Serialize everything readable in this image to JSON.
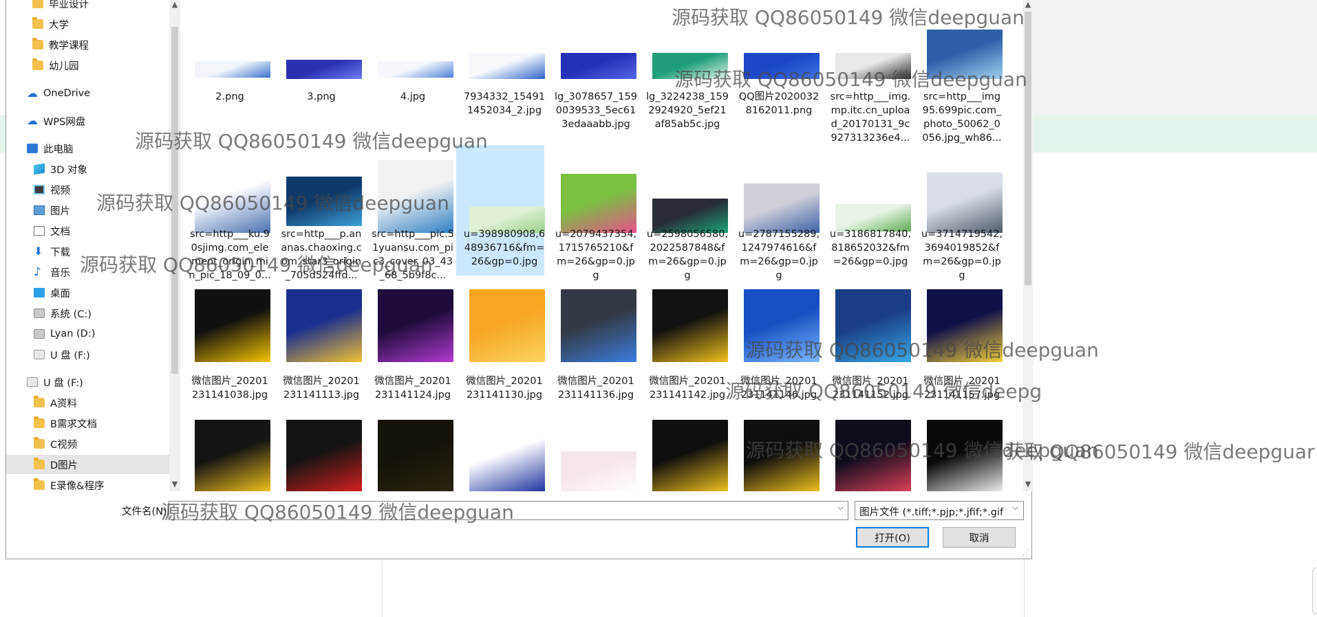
{
  "navigation": {
    "items": [
      {
        "label": "毕业设计",
        "icon": "folder-icon",
        "name": "nav-folder-graduation"
      },
      {
        "label": "大学",
        "icon": "folder-icon",
        "name": "nav-folder-university"
      },
      {
        "label": "教学课程",
        "icon": "folder-icon",
        "name": "nav-folder-courses"
      },
      {
        "label": "幼儿园",
        "icon": "folder-icon",
        "name": "nav-folder-kindergarten"
      },
      {
        "label": "OneDrive",
        "icon": "cloud-icon",
        "name": "nav-onedrive"
      },
      {
        "label": "WPS网盘",
        "icon": "cloud-icon",
        "name": "nav-wps-cloud"
      },
      {
        "label": "此电脑",
        "icon": "computer-icon",
        "name": "nav-this-pc"
      },
      {
        "label": "3D 对象",
        "icon": "cube-icon",
        "name": "nav-3d-objects"
      },
      {
        "label": "视频",
        "icon": "video-icon",
        "name": "nav-videos"
      },
      {
        "label": "图片",
        "icon": "picture-icon",
        "name": "nav-pictures"
      },
      {
        "label": "文档",
        "icon": "document-icon",
        "name": "nav-documents"
      },
      {
        "label": "下载",
        "icon": "download-icon",
        "name": "nav-downloads"
      },
      {
        "label": "音乐",
        "icon": "music-icon",
        "name": "nav-music"
      },
      {
        "label": "桌面",
        "icon": "desktop-icon",
        "name": "nav-desktop"
      },
      {
        "label": "系统 (C:)",
        "icon": "drive-icon",
        "name": "nav-drive-c"
      },
      {
        "label": "Lyan (D:)",
        "icon": "drive-icon",
        "name": "nav-drive-d"
      },
      {
        "label": "U 盘 (F:)",
        "icon": "usb-drive-icon",
        "name": "nav-drive-f"
      },
      {
        "label": "U 盘 (F:)",
        "icon": "usb-drive-icon",
        "name": "nav-usb-f-root"
      },
      {
        "label": "A资料",
        "icon": "folder-icon",
        "name": "nav-folder-a"
      },
      {
        "label": "B需求文档",
        "icon": "folder-icon",
        "name": "nav-folder-b"
      },
      {
        "label": "C视频",
        "icon": "folder-icon",
        "name": "nav-folder-c"
      },
      {
        "label": "D图片",
        "icon": "folder-icon",
        "name": "nav-folder-d",
        "selected": true
      },
      {
        "label": "E录像&程序",
        "icon": "folder-icon",
        "name": "nav-folder-e"
      }
    ]
  },
  "files": [
    {
      "name": "2.png",
      "colors": [
        "#f2f6fb",
        "#3b6fd0"
      ]
    },
    {
      "name": "3.png",
      "colors": [
        "#2b2fb0",
        "#6f7ef0"
      ]
    },
    {
      "name": "4.jpg",
      "colors": [
        "#f5f8fc",
        "#4c7fd8"
      ]
    },
    {
      "name": "7934332_154911452034_2.jpg",
      "colors": [
        "#f7f9fd",
        "#2d64c8"
      ]
    },
    {
      "name": "lg_3078657_1590039533_5ec613edaaabb.jpg",
      "colors": [
        "#2430b8",
        "#5566e8"
      ]
    },
    {
      "name": "lg_3224238_1592924920_5ef21af85ab5c.jpg",
      "colors": [
        "#1e9e7a",
        "#e6f4ee"
      ]
    },
    {
      "name": "QQ图片20200328162011.png",
      "colors": [
        "#1b47c6",
        "#3f73e6"
      ]
    },
    {
      "name": "src=http___img.mp.itc.cn_upload_20170131_9c927313236e4...",
      "colors": [
        "#e9e9e9",
        "#2a2a2a"
      ]
    },
    {
      "name": "src=http___img95.699pic.com_photo_50062_0056.jpg_wh86...",
      "colors": [
        "#2f5fa8",
        "#9fd2f2"
      ]
    },
    {
      "name": "src=http___ku.90sjimg.com_element_origin_min_pic_18_09_0...",
      "colors": [
        "#ffffff",
        "#4a6fb0"
      ]
    },
    {
      "name": "src=http___p.ananas.chaoxing.com_star3_origin_705d524ffd...",
      "colors": [
        "#0e3a6b",
        "#3fa0d8"
      ]
    },
    {
      "name": "src=http___pic.51yuansu.com_pic3_cover_03_43_68_5b9f8c...",
      "colors": [
        "#f1f1f1",
        "#2d7fc6"
      ]
    },
    {
      "name": "u=398980908,648936716&fm=26&gp=0.jpg",
      "colors": [
        "#dff0d6",
        "#9bcf8a"
      ]
    },
    {
      "name": "u=2079437354,1715765210&fm=26&gp=0.jpg",
      "colors": [
        "#7ac142",
        "#e84f8c"
      ]
    },
    {
      "name": "u=2598056580,2022587848&fm=26&gp=0.jpg",
      "colors": [
        "#2a2d36",
        "#1aa57a"
      ]
    },
    {
      "name": "u=2787155289,1247974616&fm=26&gp=0.jpg",
      "colors": [
        "#cfcfd8",
        "#3c5ea8"
      ]
    },
    {
      "name": "u=3186817840,818652032&fm=26&gp=0.jpg",
      "colors": [
        "#e8f3e6",
        "#5cab52"
      ]
    },
    {
      "name": "u=3714719542,3694019852&fm=26&gp=0.jpg",
      "colors": [
        "#d9dee6",
        "#4c5a6a"
      ]
    },
    {
      "name": "微信图片_20201231141038.jpg",
      "colors": [
        "#111111",
        "#f5c400"
      ]
    },
    {
      "name": "微信图片_20201231141113.jpg",
      "colors": [
        "#1c2f8e",
        "#f1c232"
      ]
    },
    {
      "name": "微信图片_20201231141124.jpg",
      "colors": [
        "#1d0c3c",
        "#b23ad0"
      ]
    },
    {
      "name": "微信图片_20201231141130.jpg",
      "colors": [
        "#f6a623",
        "#fbd35c"
      ]
    },
    {
      "name": "微信图片_20201231141136.jpg",
      "colors": [
        "#343a45",
        "#3b7de0"
      ]
    },
    {
      "name": "微信图片_20201231141142.jpg",
      "colors": [
        "#121212",
        "#f2c11a"
      ]
    },
    {
      "name": "微信图片_20201231141146.jpg",
      "colors": [
        "#1650c2",
        "#7ab8ff"
      ]
    },
    {
      "name": "微信图片_20201231141152.jpg",
      "colors": [
        "#1a3f86",
        "#39a8e6"
      ]
    },
    {
      "name": "微信图片_20201231141157.jpg",
      "colors": [
        "#11114a",
        "#f3d23a"
      ]
    },
    {
      "name": "",
      "colors": [
        "#141414",
        "#f3c31c"
      ]
    },
    {
      "name": "",
      "colors": [
        "#141414",
        "#d81e1e"
      ]
    },
    {
      "name": "",
      "colors": [
        "#151208",
        "#2a2410"
      ]
    },
    {
      "name": "",
      "colors": [
        "#ffffff",
        "#1c2f9e"
      ]
    },
    {
      "name": "",
      "colors": [
        "#f6e6ec",
        "#ffffff"
      ]
    },
    {
      "name": "",
      "colors": [
        "#0f0f0f",
        "#f3c31c"
      ]
    },
    {
      "name": "",
      "colors": [
        "#0f0f0f",
        "#f3c31c"
      ]
    },
    {
      "name": "",
      "colors": [
        "#0d0d1c",
        "#e0405c"
      ]
    },
    {
      "name": "",
      "colors": [
        "#0a0a0a",
        "#f0f0f0"
      ]
    }
  ],
  "bottom_bar": {
    "filename_label": "文件名(N):",
    "filename_value": "",
    "filetype_value": "图片文件 (*.tiff;*.pjp;*.jfif;*.gif",
    "open_button": "打开(O)",
    "cancel_button": "取消"
  },
  "watermarks": [
    "源码获取 QQ86050149 微信deepguan",
    "源码获取 QQ86050149 微信deepguan",
    "源码获取 QQ86050149 微信deepguan",
    "源码获取 QQ86050149 微信deepguan",
    "源码获取 QQ86050149 微信deepguan",
    "源码获取 QQ86050149 微信deepg",
    "源码获取 QQ86050149 微信deepguan",
    "获取 QQ86050149 微信deepguar",
    "源码获取 QQ86050149 微信deepguan"
  ],
  "colors": {
    "selection": "#cce8ff",
    "primary_button_border": "#0078d7",
    "background_green_band": "#e3f5ea"
  }
}
